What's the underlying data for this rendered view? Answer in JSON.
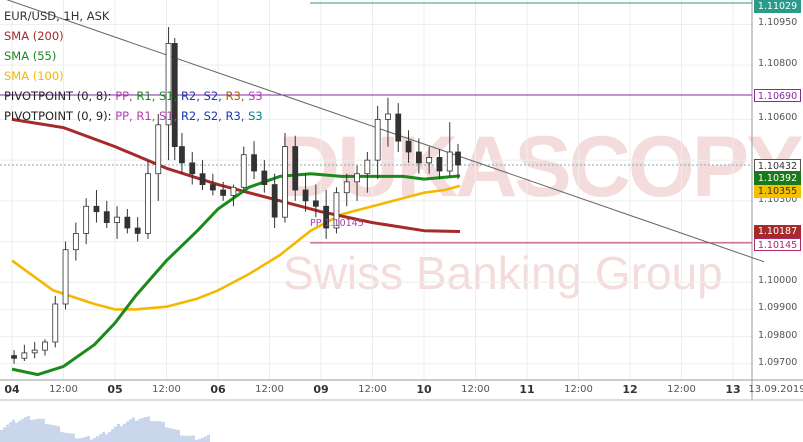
{
  "chart_data": {
    "type": "candlestick",
    "symbol": "EUR/USD, 1H, ASK",
    "watermark": "DUKASCOPY",
    "watermark_sub": "Swiss Banking Group",
    "indicators": [
      {
        "label": "SMA (200)",
        "color": "#a52a2a"
      },
      {
        "label": "SMA (55)",
        "color": "#1a8a1a"
      },
      {
        "label": "SMA (100)",
        "color": "#f5b800"
      }
    ],
    "pivot_legends": [
      {
        "prefix": "PIVOTPOINT (0, 8):",
        "items": [
          {
            "t": "PP",
            "c": "#b040b0"
          },
          {
            "t": "R1",
            "c": "#1a8a1a"
          },
          {
            "t": "S1",
            "c": "#1a8a1a"
          },
          {
            "t": "R2",
            "c": "#1a3aaa"
          },
          {
            "t": "S2",
            "c": "#1a3aaa"
          },
          {
            "t": "R3",
            "c": "#b05a00"
          },
          {
            "t": "S3",
            "c": "#b040b0"
          }
        ]
      },
      {
        "prefix": "PIVOTPOINT (0, 9):",
        "items": [
          {
            "t": "PP",
            "c": "#b040b0"
          },
          {
            "t": "R1",
            "c": "#b040b0"
          },
          {
            "t": "S1",
            "c": "#b040b0"
          },
          {
            "t": "R2",
            "c": "#1a3aaa"
          },
          {
            "t": "S2",
            "c": "#1a3aaa"
          },
          {
            "t": "R3",
            "c": "#1a3aaa"
          },
          {
            "t": "S3",
            "c": "#008080"
          }
        ]
      }
    ],
    "y_ticks": [
      "1.10950",
      "1.10800",
      "1.10600",
      "1.10450",
      "1.10300",
      "1.10150",
      "1.10000",
      "1.09900",
      "1.09800",
      "1.09700"
    ],
    "y_tick_labels_shown": [
      "1.10950",
      "1.10800",
      "1.10600",
      "1.10300",
      "1.10000",
      "1.09900",
      "1.09800",
      "1.09700"
    ],
    "ylim": [
      1.0964,
      1.1104
    ],
    "x_labels": [
      {
        "t": "04",
        "x": 0.0,
        "day": true
      },
      {
        "t": "12:00",
        "x": 0.5
      },
      {
        "t": "05",
        "x": 1.0,
        "day": true
      },
      {
        "t": "12:00",
        "x": 1.5
      },
      {
        "t": "06",
        "x": 2.0,
        "day": true
      },
      {
        "t": "12:00",
        "x": 2.5
      },
      {
        "t": "09",
        "x": 3.0,
        "day": true
      },
      {
        "t": "12:00",
        "x": 3.5
      },
      {
        "t": "10",
        "x": 4.0,
        "day": true
      },
      {
        "t": "12:00",
        "x": 4.5
      },
      {
        "t": "11",
        "x": 5.0,
        "day": true
      },
      {
        "t": "12:00",
        "x": 5.5
      },
      {
        "t": "12",
        "x": 6.0,
        "day": true
      },
      {
        "t": "12:00",
        "x": 6.5
      },
      {
        "t": "13",
        "x": 7.0,
        "day": true
      },
      {
        "t": "13.09.2019",
        "x": 7.45
      }
    ],
    "price_tags": [
      {
        "t": "1.11029",
        "bg": "#2a9a8a",
        "fg": "#ffffff",
        "v": 1.11029
      },
      {
        "t": "1.10690",
        "bg": "#ffffff",
        "fg": "#8a2aa0",
        "border": "#8a2aa0",
        "v": 1.1069
      },
      {
        "t": "1.10432",
        "bg": "#ffffff",
        "fg": "#333333",
        "border": "#555",
        "v": 1.10432
      },
      {
        "t": "1.10392",
        "bg": "#1a7a1a",
        "fg": "#ffffff",
        "v": 1.10392
      },
      {
        "t": "1.10355",
        "bg": "#f5c000",
        "fg": "#333333",
        "v": 1.10355
      },
      {
        "t": "1.10187",
        "bg": "#a52a2a",
        "fg": "#ffffff",
        "v": 1.10187
      },
      {
        "t": "1.10145",
        "bg": "#ffffff",
        "fg": "#b02a6a",
        "border": "#b02a6a",
        "v": 1.10145
      }
    ],
    "levels": {
      "r_top": 1.11029,
      "r_pivot": 1.1069,
      "pp": 1.10145,
      "current": 1.10432
    },
    "pp_label": "PP 1.10145",
    "trendline": {
      "x0": 0.0,
      "y0": 1.1105,
      "x1": 4.68,
      "y1": 1.1042
    },
    "sma200": {
      "x": [
        0,
        0.5,
        1.0,
        1.5,
        2.0,
        2.5,
        3.0,
        3.5,
        4.0,
        4.35
      ],
      "y": [
        1.106,
        1.1057,
        1.105,
        1.1042,
        1.1036,
        1.1031,
        1.1026,
        1.1022,
        1.1019,
        1.10187
      ]
    },
    "sma55": {
      "x": [
        0,
        0.25,
        0.5,
        0.8,
        1.0,
        1.2,
        1.5,
        1.8,
        2.0,
        2.3,
        2.6,
        2.9,
        3.2,
        3.5,
        3.8,
        4.0,
        4.35
      ],
      "y": [
        1.0968,
        1.0966,
        1.0969,
        1.0977,
        1.0985,
        1.0995,
        1.1008,
        1.1019,
        1.1027,
        1.1035,
        1.1039,
        1.104,
        1.1039,
        1.1039,
        1.1039,
        1.1038,
        1.10392
      ]
    },
    "sma100": {
      "x": [
        0,
        0.4,
        0.8,
        1.0,
        1.2,
        1.5,
        1.8,
        2.0,
        2.3,
        2.6,
        2.9,
        3.2,
        3.5,
        3.8,
        4.0,
        4.2,
        4.35
      ],
      "y": [
        1.1008,
        1.0997,
        1.0992,
        1.099,
        1.099,
        1.0991,
        1.0994,
        1.0997,
        1.1003,
        1.101,
        1.1019,
        1.1025,
        1.1028,
        1.1031,
        1.1033,
        1.1034,
        1.10355
      ]
    },
    "candles": [
      {
        "x": 0.02,
        "o": 1.0973,
        "h": 1.0975,
        "l": 1.097,
        "c": 1.0972
      },
      {
        "x": 0.12,
        "o": 1.0972,
        "h": 1.0977,
        "l": 1.0971,
        "c": 1.0974
      },
      {
        "x": 0.22,
        "o": 1.0974,
        "h": 1.0978,
        "l": 1.0972,
        "c": 1.0975
      },
      {
        "x": 0.32,
        "o": 1.0975,
        "h": 1.0979,
        "l": 1.0973,
        "c": 1.0978
      },
      {
        "x": 0.42,
        "o": 1.0978,
        "h": 1.0995,
        "l": 1.0976,
        "c": 1.0992
      },
      {
        "x": 0.52,
        "o": 1.0992,
        "h": 1.1015,
        "l": 1.099,
        "c": 1.1012
      },
      {
        "x": 0.62,
        "o": 1.1012,
        "h": 1.1022,
        "l": 1.1008,
        "c": 1.1018
      },
      {
        "x": 0.72,
        "o": 1.1018,
        "h": 1.1031,
        "l": 1.1014,
        "c": 1.1028
      },
      {
        "x": 0.82,
        "o": 1.1028,
        "h": 1.1034,
        "l": 1.1022,
        "c": 1.1026
      },
      {
        "x": 0.92,
        "o": 1.1026,
        "h": 1.103,
        "l": 1.102,
        "c": 1.1022
      },
      {
        "x": 1.02,
        "o": 1.1022,
        "h": 1.1028,
        "l": 1.1016,
        "c": 1.1024
      },
      {
        "x": 1.12,
        "o": 1.1024,
        "h": 1.1027,
        "l": 1.1018,
        "c": 1.102
      },
      {
        "x": 1.22,
        "o": 1.102,
        "h": 1.1024,
        "l": 1.1015,
        "c": 1.1018
      },
      {
        "x": 1.32,
        "o": 1.1018,
        "h": 1.1045,
        "l": 1.1016,
        "c": 1.104
      },
      {
        "x": 1.42,
        "o": 1.104,
        "h": 1.1062,
        "l": 1.103,
        "c": 1.1058
      },
      {
        "x": 1.52,
        "o": 1.1058,
        "h": 1.1094,
        "l": 1.1045,
        "c": 1.1088
      },
      {
        "x": 1.58,
        "o": 1.1088,
        "h": 1.109,
        "l": 1.1045,
        "c": 1.105
      },
      {
        "x": 1.65,
        "o": 1.105,
        "h": 1.1055,
        "l": 1.104,
        "c": 1.1044
      },
      {
        "x": 1.75,
        "o": 1.1044,
        "h": 1.1048,
        "l": 1.1036,
        "c": 1.104
      },
      {
        "x": 1.85,
        "o": 1.104,
        "h": 1.1045,
        "l": 1.1034,
        "c": 1.1036
      },
      {
        "x": 1.95,
        "o": 1.1036,
        "h": 1.104,
        "l": 1.1032,
        "c": 1.1034
      },
      {
        "x": 2.05,
        "o": 1.1034,
        "h": 1.1037,
        "l": 1.103,
        "c": 1.1032
      },
      {
        "x": 2.15,
        "o": 1.1032,
        "h": 1.1036,
        "l": 1.1028,
        "c": 1.1035
      },
      {
        "x": 2.25,
        "o": 1.1035,
        "h": 1.105,
        "l": 1.1033,
        "c": 1.1047
      },
      {
        "x": 2.35,
        "o": 1.1047,
        "h": 1.1052,
        "l": 1.1038,
        "c": 1.1041
      },
      {
        "x": 2.45,
        "o": 1.1041,
        "h": 1.1045,
        "l": 1.1033,
        "c": 1.1036
      },
      {
        "x": 2.55,
        "o": 1.1036,
        "h": 1.104,
        "l": 1.102,
        "c": 1.1024
      },
      {
        "x": 2.65,
        "o": 1.1024,
        "h": 1.1055,
        "l": 1.1022,
        "c": 1.105
      },
      {
        "x": 2.75,
        "o": 1.105,
        "h": 1.1054,
        "l": 1.103,
        "c": 1.1034
      },
      {
        "x": 2.85,
        "o": 1.1034,
        "h": 1.104,
        "l": 1.1026,
        "c": 1.103
      },
      {
        "x": 2.95,
        "o": 1.103,
        "h": 1.1036,
        "l": 1.1024,
        "c": 1.1028
      },
      {
        "x": 3.05,
        "o": 1.1028,
        "h": 1.1034,
        "l": 1.1016,
        "c": 1.102
      },
      {
        "x": 3.15,
        "o": 1.102,
        "h": 1.1035,
        "l": 1.1018,
        "c": 1.1033
      },
      {
        "x": 3.25,
        "o": 1.1033,
        "h": 1.104,
        "l": 1.1028,
        "c": 1.1037
      },
      {
        "x": 3.35,
        "o": 1.1037,
        "h": 1.1043,
        "l": 1.103,
        "c": 1.104
      },
      {
        "x": 3.45,
        "o": 1.104,
        "h": 1.1048,
        "l": 1.1033,
        "c": 1.1045
      },
      {
        "x": 3.55,
        "o": 1.1045,
        "h": 1.1065,
        "l": 1.1038,
        "c": 1.106
      },
      {
        "x": 3.65,
        "o": 1.106,
        "h": 1.1068,
        "l": 1.105,
        "c": 1.1062
      },
      {
        "x": 3.75,
        "o": 1.1062,
        "h": 1.1066,
        "l": 1.1048,
        "c": 1.1052
      },
      {
        "x": 3.85,
        "o": 1.1052,
        "h": 1.1056,
        "l": 1.1044,
        "c": 1.1048
      },
      {
        "x": 3.95,
        "o": 1.1048,
        "h": 1.1053,
        "l": 1.104,
        "c": 1.1044
      },
      {
        "x": 4.05,
        "o": 1.1044,
        "h": 1.105,
        "l": 1.104,
        "c": 1.1046
      },
      {
        "x": 4.15,
        "o": 1.1046,
        "h": 1.1049,
        "l": 1.1038,
        "c": 1.1041
      },
      {
        "x": 4.25,
        "o": 1.1041,
        "h": 1.1059,
        "l": 1.1039,
        "c": 1.1048
      },
      {
        "x": 4.33,
        "o": 1.1048,
        "h": 1.1051,
        "l": 1.1038,
        "c": 1.10432
      }
    ]
  }
}
